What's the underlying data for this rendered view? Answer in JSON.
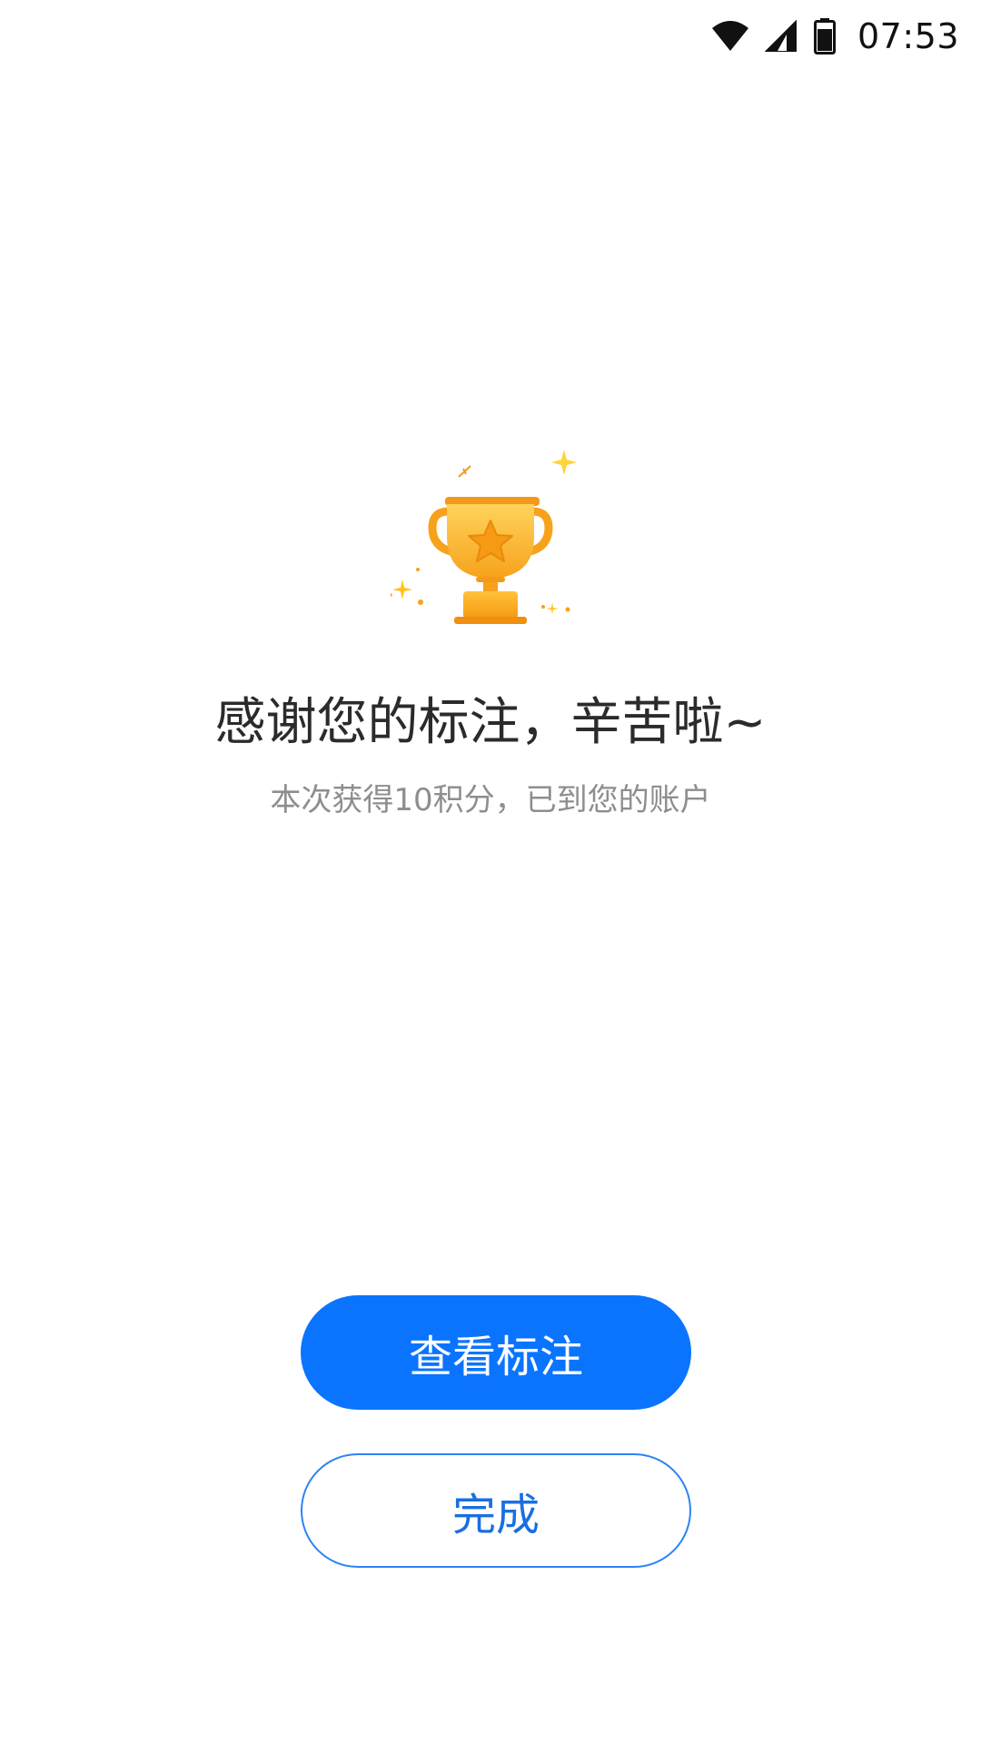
{
  "status_bar": {
    "time": "07:53",
    "icons": [
      "wifi-icon",
      "cellular-signal-icon",
      "battery-icon"
    ]
  },
  "result": {
    "icon": "trophy-icon",
    "title": "感谢您的标注，辛苦啦~",
    "subtitle": "本次获得10积分，已到您的账户"
  },
  "actions": {
    "view_label": "查看标注",
    "done_label": "完成"
  },
  "colors": {
    "primary": "#0a74ff",
    "secondary_border": "#2d83f5",
    "trophy_gold": "#f5a623"
  }
}
